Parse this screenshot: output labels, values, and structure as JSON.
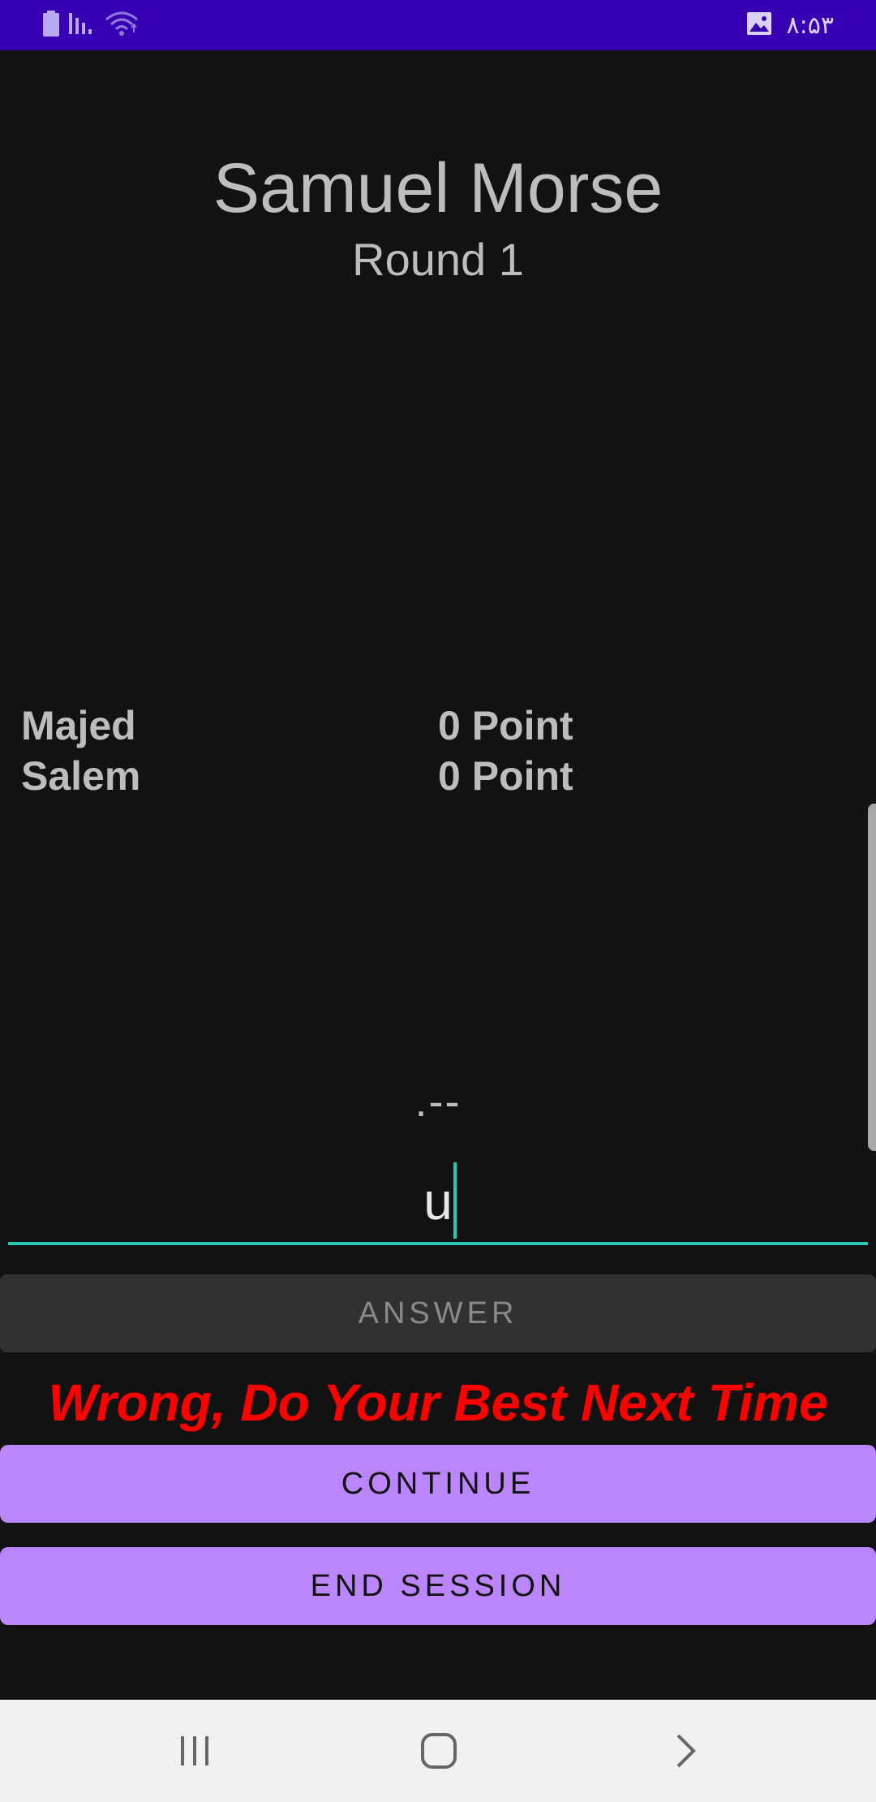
{
  "status_bar": {
    "time": "۸:۵۳",
    "icons": [
      "battery-icon",
      "signal-icon",
      "wifi-icon",
      "image-icon"
    ]
  },
  "game": {
    "title": "Samuel Morse",
    "round_label": "Round 1"
  },
  "scores": [
    {
      "name": "Majed",
      "points": "0 Point"
    },
    {
      "name": "Salem",
      "points": "0 Point"
    }
  ],
  "question": {
    "morse_code": ".--"
  },
  "answer": {
    "value": "u",
    "button_label": "ANSWER"
  },
  "feedback": {
    "message": "Wrong, Do Your Best Next Time",
    "color": "#ff0000"
  },
  "actions": {
    "continue_label": "CONTINUE",
    "end_session_label": "END SESSION"
  },
  "nav_bar": {
    "icons": [
      "recent-apps-icon",
      "home-icon",
      "back-icon"
    ]
  },
  "colors": {
    "status_bar": "#3700b3",
    "background": "#121212",
    "accent": "#bb86fc",
    "field_underline": "#26c6b0"
  }
}
